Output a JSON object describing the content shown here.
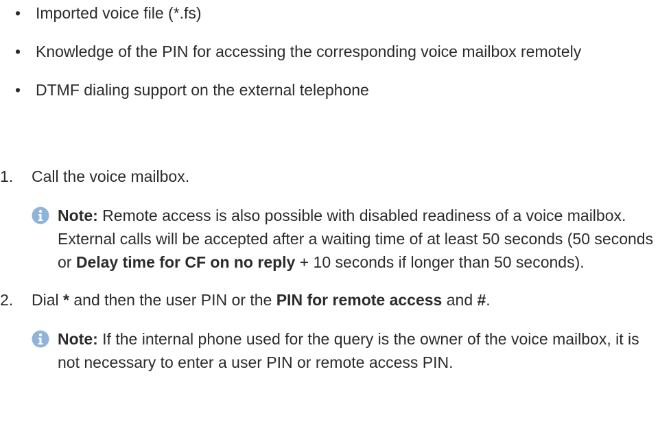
{
  "prerequisites": [
    "Imported voice file (*.fs)",
    "Knowledge of the PIN for accessing the corresponding voice mailbox remotely",
    "DTMF dialing support on the external telephone"
  ],
  "bullet_glyph": "•",
  "step1": {
    "number": "1.",
    "text": "Call the voice mailbox.",
    "note": {
      "label": "Note:",
      "t1": " Remote access is also possible with disabled readiness of a voice mailbox. External calls will be accepted after a waiting time of at least 50 seconds (50 seconds or ",
      "b1": "Delay time for CF on no reply",
      "t2": " + 10 seconds if longer than 50 seconds)."
    }
  },
  "step2": {
    "number": "2.",
    "t1": "Dial ",
    "b1": "*",
    "t2": " and then the user PIN or the ",
    "b2": "PIN for remote access",
    "t3": " and ",
    "b3": "#",
    "t4": ".",
    "note": {
      "label": "Note:",
      "t1": " If the internal phone used for the query is the owner of the voice mailbox, it is not necessary to enter a user PIN or remote access PIN."
    }
  },
  "colors": {
    "text": "#2b2b2b",
    "note_icon": "#8fb3d9"
  },
  "icons": {
    "note": "info-icon"
  }
}
